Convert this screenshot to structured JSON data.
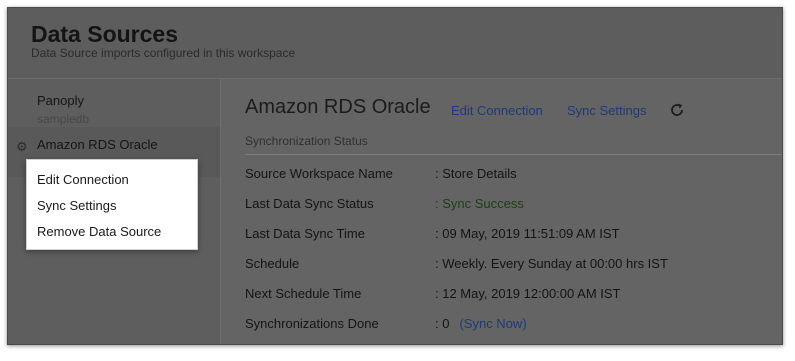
{
  "header": {
    "title": "Data Sources",
    "subtitle": "Data Source imports configured in this workspace"
  },
  "sidebar": {
    "items": [
      {
        "name": "Panoply",
        "db": "sampledb"
      },
      {
        "name": "Amazon RDS Oracle",
        "db": ""
      }
    ]
  },
  "context_menu": {
    "items": [
      "Edit Connection",
      "Sync Settings",
      "Remove Data Source"
    ]
  },
  "main": {
    "title": "Amazon RDS Oracle",
    "edit_connection": "Edit Connection",
    "sync_settings": "Sync Settings",
    "refresh_icon": "refresh-icon",
    "status_label": "Synchronization Status",
    "rows": [
      {
        "label": "Source Workspace Name",
        "value": ": Store Details"
      },
      {
        "label": "Last Data Sync Status",
        "value": ": Sync Success"
      },
      {
        "label": "Last Data Sync Time",
        "value": ": 09 May, 2019 11:51:09 AM IST"
      },
      {
        "label": "Schedule",
        "value": ": Weekly. Every Sunday at 00:00 hrs IST"
      },
      {
        "label": "Next Schedule Time",
        "value": ": 12 May, 2019 12:00:00 AM IST"
      },
      {
        "label": "Synchronizations Done",
        "value": ": 0"
      }
    ],
    "sync_now": "(Sync Now)"
  },
  "colors": {
    "overlay": "#646464",
    "link": "#1d3a78",
    "success": "#1e3d16"
  }
}
